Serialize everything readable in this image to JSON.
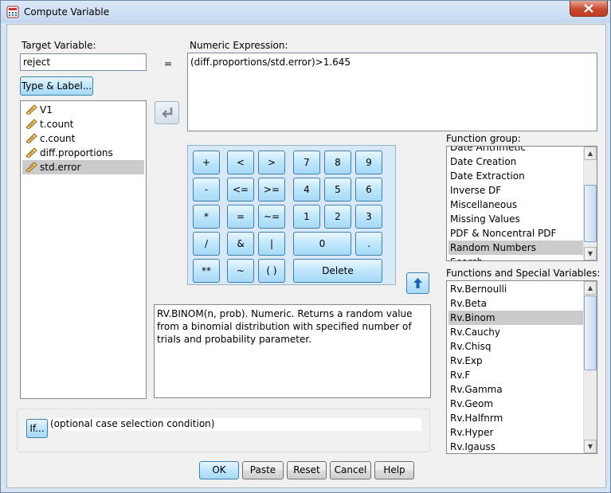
{
  "window": {
    "title": "Compute Variable"
  },
  "target_variable": {
    "label": "Target Variable:",
    "value": "reject",
    "equals": "="
  },
  "type_label_button": "Type & Label...",
  "numeric_expression": {
    "label": "Numeric Expression:",
    "value": "(diff.proportions/std.error)>1.645"
  },
  "variables": {
    "items": [
      {
        "label": "V1"
      },
      {
        "label": "t.count"
      },
      {
        "label": "c.count"
      },
      {
        "label": "diff.proportions"
      },
      {
        "label": "std.error",
        "selected": true
      }
    ]
  },
  "keypad": {
    "plus": "+",
    "lt": "<",
    "gt": ">",
    "k7": "7",
    "k8": "8",
    "k9": "9",
    "minus": "-",
    "le": "<=",
    "ge": ">=",
    "k4": "4",
    "k5": "5",
    "k6": "6",
    "mult": "*",
    "eq": "=",
    "ne": "~=",
    "k1": "1",
    "k2": "2",
    "k3": "3",
    "div": "/",
    "and": "&",
    "or": "|",
    "k0": "0",
    "dot": ".",
    "pow": "**",
    "not": "~",
    "parens": "( )",
    "delete": "Delete"
  },
  "description": "RV.BINOM(n, prob). Numeric. Returns a random value from a binomial distribution with specified number of trials and probability parameter.",
  "function_group": {
    "label": "Function group:",
    "partial_top": "Date Arithmetic",
    "items": [
      "Date Creation",
      "Date Extraction",
      "Inverse DF",
      "Miscellaneous",
      "Missing Values",
      "PDF & Noncentral PDF",
      "Random Numbers"
    ],
    "partial_bottom": "Search",
    "selected": "Random Numbers"
  },
  "functions": {
    "label": "Functions and Special Variables:",
    "items": [
      "Rv.Bernoulli",
      "Rv.Beta",
      "Rv.Binom",
      "Rv.Cauchy",
      "Rv.Chisq",
      "Rv.Exp",
      "Rv.F",
      "Rv.Gamma",
      "Rv.Geom",
      "Rv.Halfnrm",
      "Rv.Hyper",
      "Rv.Igauss"
    ],
    "selected": "Rv.Binom"
  },
  "if_section": {
    "button": "If...",
    "text": "(optional case selection condition)"
  },
  "buttons": {
    "ok": "OK",
    "paste": "Paste",
    "reset": "Reset",
    "cancel": "Cancel",
    "help": "Help"
  },
  "colors": {
    "title_bar": "#c9dcf0",
    "selection": "#cbcbcb",
    "button_blue": "#bee6fd",
    "close_red": "#c74a2f"
  },
  "icons": {
    "app": "calculator-icon",
    "close": "close-icon",
    "transfer_left": "arrow-left-icon",
    "transfer_up": "arrow-up-icon",
    "variable": "ruler-icon"
  }
}
